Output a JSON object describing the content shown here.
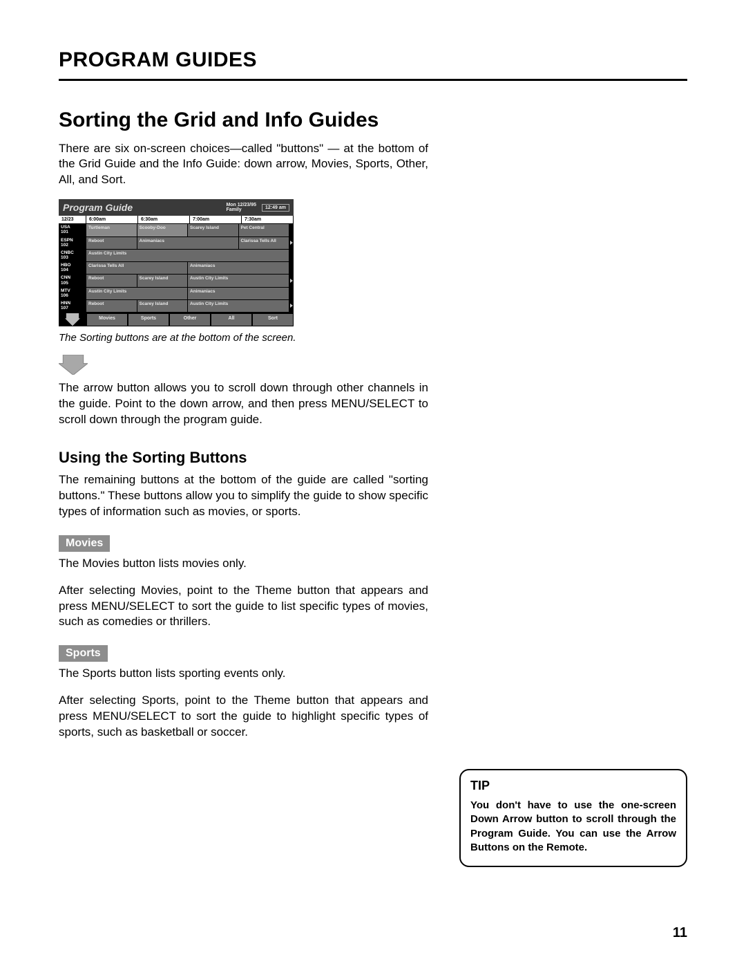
{
  "header": {
    "title": "PROGRAM GUIDES"
  },
  "section": {
    "title": "Sorting the Grid and Info Guides",
    "intro": "There are six on-screen choices—called \"buttons\" — at the bottom of the Grid Guide and the Info Guide: down arrow, Movies, Sports, Other, All, and Sort."
  },
  "guide": {
    "title": "Program Guide",
    "date_line1": "Mon 12/23/95",
    "date_line2": "Family",
    "clock": "12:49 am",
    "timerow": {
      "date": "12/23",
      "t1": "6:00am",
      "t2": "6:30am",
      "t3": "7:00am",
      "t4": "7:30am"
    },
    "rows": [
      {
        "ch_name": "USA",
        "ch_num": "101",
        "cells": [
          "Turtleman",
          "Scooby-Doo",
          "Scarey Island",
          "Pet Central"
        ],
        "spans": [
          1,
          1,
          1,
          1
        ],
        "dark": [
          0,
          0,
          1,
          1
        ],
        "tri": false
      },
      {
        "ch_name": "ESPN",
        "ch_num": "102",
        "cells": [
          "Reboot",
          "Animaniacs",
          "Clarissa Tells All"
        ],
        "spans": [
          1,
          2,
          1
        ],
        "dark": [
          1,
          1,
          1
        ],
        "tri": true
      },
      {
        "ch_name": "CNBC",
        "ch_num": "103",
        "cells": [
          "Austin City Limits"
        ],
        "spans": [
          4
        ],
        "dark": [
          1
        ],
        "tri": false
      },
      {
        "ch_name": "HBO",
        "ch_num": "104",
        "cells": [
          "Clarissa Tells All",
          "Animaniacs"
        ],
        "spans": [
          2,
          2
        ],
        "dark": [
          1,
          1
        ],
        "tri": false
      },
      {
        "ch_name": "CNN",
        "ch_num": "105",
        "cells": [
          "Reboot",
          "Scarey Island",
          "Austin City Limits"
        ],
        "spans": [
          1,
          1,
          2
        ],
        "dark": [
          1,
          1,
          1
        ],
        "tri": true
      },
      {
        "ch_name": "MTV",
        "ch_num": "106",
        "cells": [
          "Austin City Limits",
          "Animaniacs"
        ],
        "spans": [
          2,
          2
        ],
        "dark": [
          1,
          1
        ],
        "tri": false
      },
      {
        "ch_name": "HNN",
        "ch_num": "107",
        "cells": [
          "Reboot",
          "Scarey Island",
          "Austin City Limits"
        ],
        "spans": [
          1,
          1,
          2
        ],
        "dark": [
          1,
          1,
          1
        ],
        "tri": true
      }
    ],
    "footer_buttons": [
      "Movies",
      "Sports",
      "Other",
      "All",
      "Sort"
    ]
  },
  "caption": "The Sorting buttons are at the bottom of the screen.",
  "arrow_para": "The arrow button allows you to scroll down through other channels in the guide. Point to the down arrow, and then press MENU/SELECT to scroll down through the program guide.",
  "subsection": {
    "title": "Using the Sorting Buttons",
    "intro": "The remaining buttons at the bottom of the guide are called \"sorting buttons.\" These buttons allow you to simplify the guide to show specific types of information such as movies, or sports."
  },
  "movies": {
    "chip": "Movies",
    "p1": "The Movies button lists movies only.",
    "p2": "After selecting Movies, point to the Theme button that appears and press MENU/SELECT to sort the guide to list specific types of movies, such as comedies or thrillers."
  },
  "sports": {
    "chip": "Sports",
    "p1": "The Sports button lists sporting events only.",
    "p2": "After selecting Sports, point to the Theme button that appears and press MENU/SELECT to sort the guide to highlight specific types of sports, such as basketball or soccer."
  },
  "tip": {
    "title": "TIP",
    "body": "You don't have to use the one-screen Down Arrow button to scroll through the Program Guide. You can use the Arrow Buttons on the Remote."
  },
  "page_number": "11"
}
